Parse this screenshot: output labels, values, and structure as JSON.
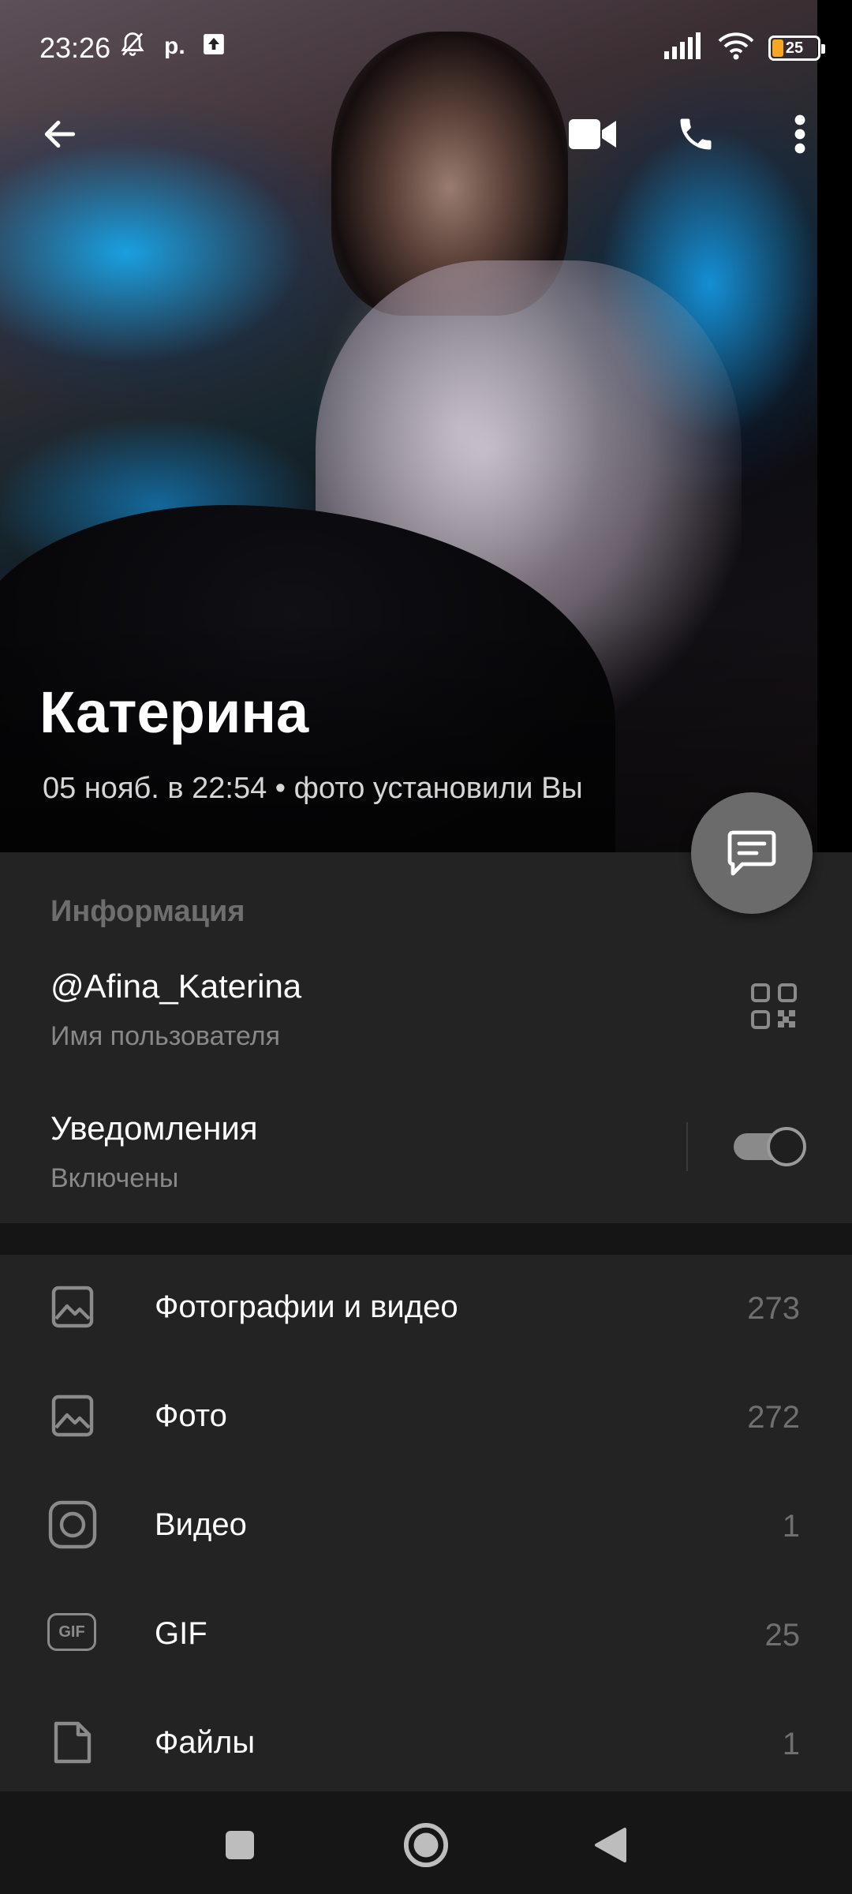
{
  "status_bar": {
    "time": "23:26",
    "left_icons": [
      "muted-bell-icon",
      "p-icon",
      "upload-icon"
    ],
    "p_glyph": "р.",
    "battery_level": "25",
    "battery_color": "#f5a623"
  },
  "toolbar": {
    "back_icon": "arrow-left-icon",
    "video_call_icon": "video-camera-icon",
    "call_icon": "phone-icon",
    "menu_icon": "more-vertical-icon"
  },
  "profile": {
    "name": "Катерина",
    "subtitle": "05 нояб. в 22:54 • фото установили Вы"
  },
  "fab": {
    "icon": "message-icon"
  },
  "info": {
    "header": "Информация",
    "username": "@Afina_Katerina",
    "username_caption": "Имя пользователя",
    "notifications_label": "Уведомления",
    "notifications_state": "Включены",
    "notifications_enabled": true
  },
  "media": {
    "items": [
      {
        "label": "Фотографии и видео",
        "count": "273",
        "icon": "image-icon"
      },
      {
        "label": "Фото",
        "count": "272",
        "icon": "image-icon"
      },
      {
        "label": "Видео",
        "count": "1",
        "icon": "video-icon"
      },
      {
        "label": "GIF",
        "count": "25",
        "icon": "gif-icon",
        "icon_text": "GIF"
      },
      {
        "label": "Файлы",
        "count": "1",
        "icon": "file-icon"
      }
    ]
  },
  "navbar": {
    "recents_icon": "square-icon",
    "home_icon": "home-circle-icon",
    "back_icon": "triangle-back-icon"
  }
}
